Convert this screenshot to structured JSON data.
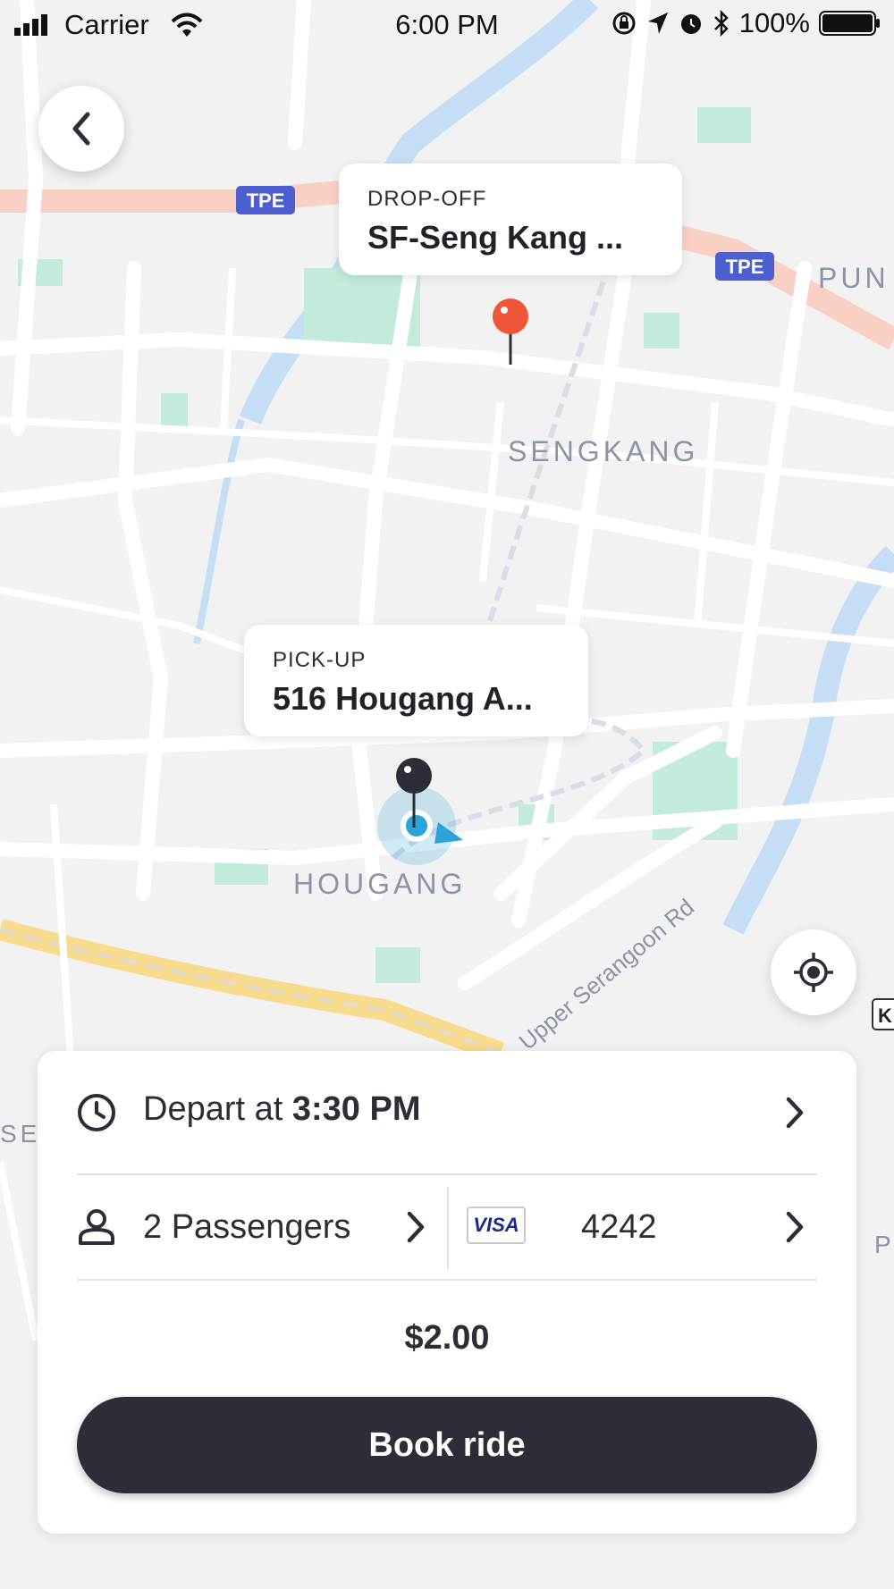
{
  "status_bar": {
    "carrier": "Carrier",
    "time": "6:00 PM",
    "battery": "100%",
    "icons": [
      "signal-icon",
      "wifi-icon",
      "orientation-lock-icon",
      "location-arrow-icon",
      "alarm-icon",
      "bluetooth-icon",
      "battery-icon"
    ]
  },
  "map": {
    "labels": {
      "tpe_1": "TPE",
      "tpe_2": "TPE",
      "pun": "PUN",
      "sengkang": "SENGKANG",
      "hougang": "HOUGANG",
      "road": "Upper Serangoon Rd",
      "edge_k": "K",
      "edge_p": "P",
      "edge_se": "SE"
    },
    "colors": {
      "land": "#f2f2f2",
      "road": "#ffffff",
      "water": "#c5def5",
      "park": "#c2ecd9",
      "expressway": "#fbd0c4",
      "major_road": "#f9db8d",
      "expressway_badge": "#4b5fd1"
    }
  },
  "dropoff": {
    "kind": "DROP-OFF",
    "name": "SF-Seng Kang ...",
    "pin_color": "#f0553a"
  },
  "pickup": {
    "kind": "PICK-UP",
    "name": "516 Hougang A...",
    "pin_color": "#2b2e36",
    "current_location_color": "#2aa3d8"
  },
  "panel": {
    "depart_prefix": "Depart at",
    "depart_time": "3:30 PM",
    "passengers": "2 Passengers",
    "card_brand": "VISA",
    "card_last4": "4242",
    "price": "$2.00",
    "book_label": "Book ride"
  }
}
